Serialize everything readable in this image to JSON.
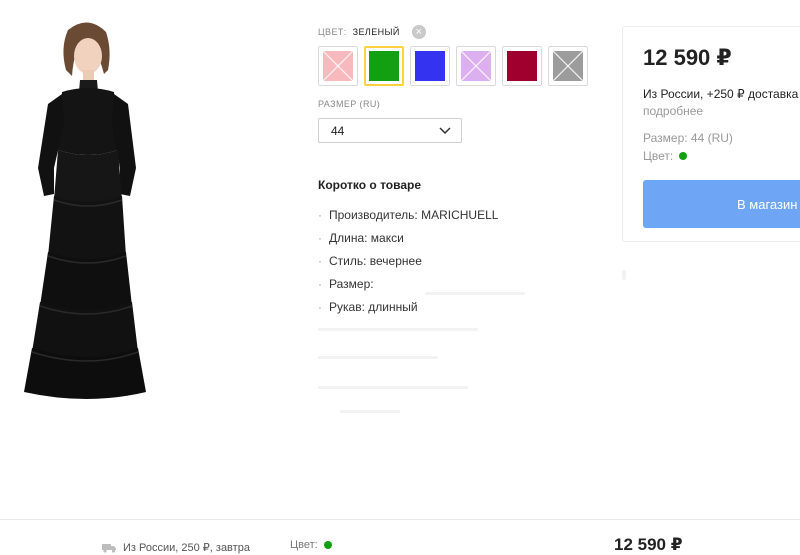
{
  "product": {
    "image_alt": "Black long-sleeve tiered maxi dress"
  },
  "color": {
    "label": "Цвет:",
    "selected": "зеленый",
    "swatches": [
      {
        "name": "pink",
        "hex": "#f7b9bd",
        "available": false
      },
      {
        "name": "green",
        "hex": "#12a012",
        "available": true,
        "selected": true
      },
      {
        "name": "blue",
        "hex": "#3333f0",
        "available": true
      },
      {
        "name": "lilac",
        "hex": "#dcb0ef",
        "available": false
      },
      {
        "name": "burgundy",
        "hex": "#a0002e",
        "available": true
      },
      {
        "name": "grey",
        "hex": "#9c9c9c",
        "available": false
      }
    ]
  },
  "size": {
    "label": "Размер (RU)",
    "value": "44"
  },
  "about": {
    "title": "Коротко о товаре",
    "items": [
      "Производитель: MARICHUELL",
      "Длина: макси",
      "Стиль: вечернее",
      "Размер:",
      "Рукав: длинный"
    ]
  },
  "card": {
    "price": "12 590 ₽",
    "delivery": "Из России, +250 ₽ доставка",
    "more": "подробнее",
    "size_text": "Размер:  44 (RU)",
    "color_label": "Цвет:",
    "color_dot": "#12a012",
    "button_label": "В магазин",
    "button_color": "#6ea6f5"
  },
  "bottom": {
    "delivery": "Из России, 250 ₽, завтра",
    "color_label": "Цвет:",
    "color_dot": "#12a012",
    "price": "12 590 ₽"
  }
}
